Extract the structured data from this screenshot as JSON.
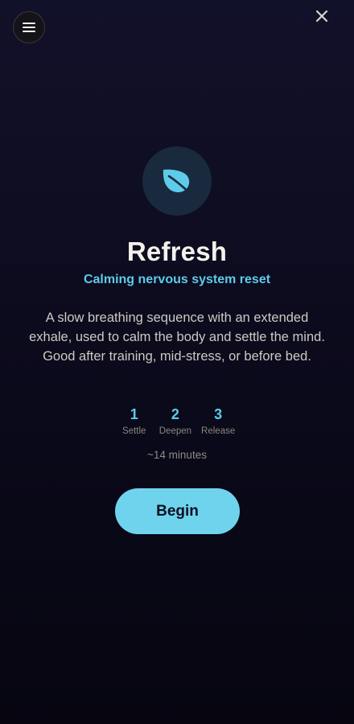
{
  "header": {
    "menu_icon": "hamburger-menu-icon",
    "close_icon": "close-icon"
  },
  "hero": {
    "icon": "leaf-icon",
    "title": "Refresh",
    "subtitle": "Calming nervous system reset",
    "description": "A slow breathing sequence with an extended exhale, used to calm the body and settle the mind. Good after training, mid-stress, or before bed."
  },
  "steps": [
    {
      "number": "1",
      "label": "Settle"
    },
    {
      "number": "2",
      "label": "Deepen"
    },
    {
      "number": "3",
      "label": "Release"
    }
  ],
  "duration": "~14 minutes",
  "actions": {
    "begin_label": "Begin"
  },
  "colors": {
    "accent": "#5ecbea",
    "button": "#6fd3ee",
    "background_top": "#12112a",
    "background_bottom": "#060510"
  }
}
